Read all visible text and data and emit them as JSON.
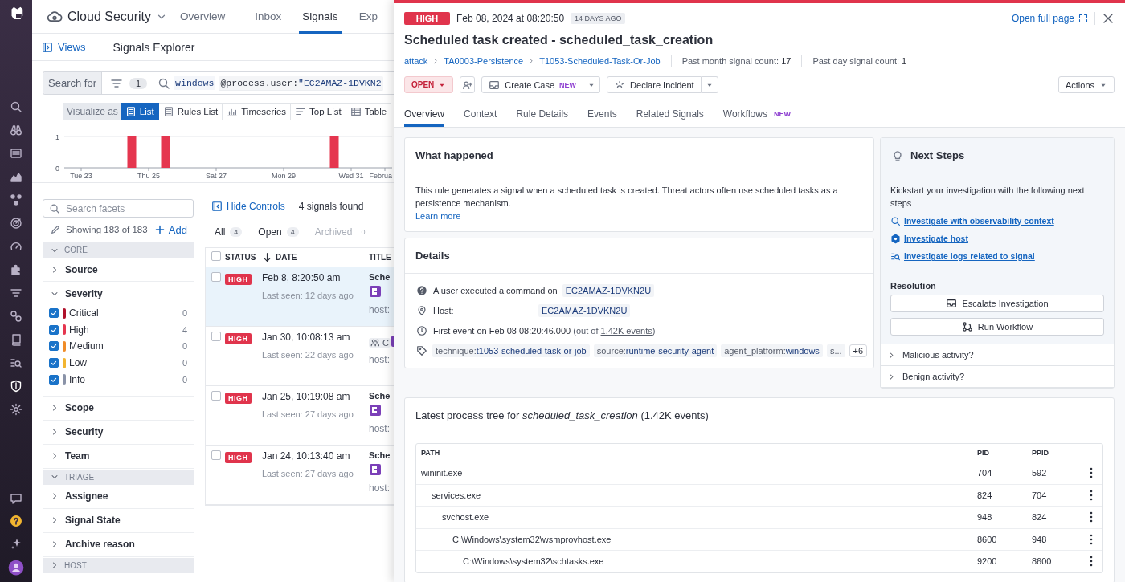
{
  "header": {
    "product": "Cloud Security",
    "tabs": [
      {
        "label": "Overview",
        "selected": false
      },
      {
        "label": "Inbox",
        "selected": false
      },
      {
        "label": "Signals",
        "selected": true
      },
      {
        "label": "Exp",
        "selected": false
      }
    ]
  },
  "subheader": {
    "views": "Views",
    "title": "Signals Explorer"
  },
  "search": {
    "label": "Search for",
    "filter_count": "1",
    "tokens": [
      {
        "kind": "keyword",
        "text": "windows"
      },
      {
        "kind": "facet",
        "key": "@process.user:",
        "value": "\"EC2AMAZ-1DVKN2"
      }
    ]
  },
  "visualize": {
    "label": "Visualize as",
    "options": [
      {
        "label": "List",
        "selected": true
      },
      {
        "label": "Rules List",
        "selected": false
      },
      {
        "label": "Timeseries",
        "selected": false
      },
      {
        "label": "Top List",
        "selected": false
      },
      {
        "label": "Table",
        "selected": false
      }
    ]
  },
  "histogram": {
    "chart_data": {
      "type": "bar",
      "categories": [
        "Tue 23",
        null,
        null,
        null,
        "Thu 25",
        null,
        null,
        null,
        "Sat 27",
        null,
        null,
        null,
        "Mon 29",
        null,
        null,
        null,
        "Wed 31",
        null,
        "Februa"
      ],
      "values": [
        0,
        0,
        0,
        1,
        0,
        1,
        0,
        0,
        0,
        0,
        0,
        0,
        0,
        0,
        0,
        1,
        0,
        0,
        0
      ],
      "ylim": [
        0,
        1
      ],
      "yticks": [
        0,
        1
      ]
    }
  },
  "facets": {
    "search_placeholder": "Search facets",
    "showing": "Showing 183 of 183",
    "add": "Add",
    "groups": [
      {
        "kind": "section",
        "label": "CORE",
        "expanded": true
      },
      {
        "kind": "facet",
        "label": "Source",
        "expanded": false
      },
      {
        "kind": "facet",
        "label": "Severity",
        "expanded": true,
        "options": [
          {
            "label": "Critical",
            "count": "0",
            "checked": true,
            "color": "#b0102a"
          },
          {
            "label": "High",
            "count": "4",
            "checked": true,
            "color": "#e5364f"
          },
          {
            "label": "Medium",
            "count": "0",
            "checked": true,
            "color": "#f08c28"
          },
          {
            "label": "Low",
            "count": "0",
            "checked": true,
            "color": "#f2b530"
          },
          {
            "label": "Info",
            "count": "0",
            "checked": true,
            "color": "#8a93a8"
          }
        ]
      },
      {
        "kind": "facet",
        "label": "Scope",
        "expanded": false
      },
      {
        "kind": "facet",
        "label": "Security",
        "expanded": false
      },
      {
        "kind": "facet",
        "label": "Team",
        "expanded": false
      },
      {
        "kind": "section",
        "label": "TRIAGE",
        "expanded": true
      },
      {
        "kind": "facet",
        "label": "Assignee",
        "expanded": false
      },
      {
        "kind": "facet",
        "label": "Signal State",
        "expanded": false
      },
      {
        "kind": "facet",
        "label": "Archive reason",
        "expanded": false
      },
      {
        "kind": "section",
        "label": "HOST",
        "expanded": false
      }
    ]
  },
  "signals": {
    "hide_controls": "Hide Controls",
    "found": "4 signals found",
    "filters": [
      {
        "label": "All",
        "count": "4",
        "disabled": false
      },
      {
        "label": "Open",
        "count": "4",
        "disabled": false
      },
      {
        "label": "Archived",
        "count": "0",
        "disabled": true
      }
    ],
    "select_all_checked": false,
    "columns": [
      "STATUS",
      "DATE",
      "TITLE"
    ],
    "rows": [
      {
        "kind": "text",
        "severity": "HIGH",
        "date": "Feb 8, 8:20:50 am",
        "last_seen": "Last seen: 12 days ago",
        "title": "Sche",
        "host": "host:",
        "selected": true,
        "checked": false
      },
      {
        "kind": "case",
        "severity": "HIGH",
        "date": "Jan 30, 10:08:13 am",
        "last_seen": "Last seen: 22 days ago",
        "title": "C",
        "host": "host:",
        "selected": false,
        "checked": false
      },
      {
        "kind": "text",
        "severity": "HIGH",
        "date": "Jan 25, 10:19:08 am",
        "last_seen": "Last seen: 27 days ago",
        "title": "Sche",
        "host": "host:",
        "selected": false,
        "checked": false
      },
      {
        "kind": "text",
        "severity": "HIGH",
        "date": "Jan 24, 10:13:40 am",
        "last_seen": "Last seen: 27 days ago",
        "title": "Sche",
        "host": "host:",
        "selected": false,
        "checked": false
      }
    ]
  },
  "panel": {
    "severity": "HIGH",
    "timestamp": "Feb 08, 2024 at 08:20:50",
    "age": "14 DAYS AGO",
    "open_full_page": "Open full page",
    "title": "Scheduled task created - scheduled_task_creation",
    "breadcrumbs": [
      "attack",
      "TA0003-Persistence",
      "T1053-Scheduled-Task-Or-Job"
    ],
    "counts": [
      "Past month signal count: **17**",
      "Past day signal count: **1**"
    ],
    "status": "OPEN",
    "create_case": {
      "label": "Create Case",
      "badge": "NEW"
    },
    "declare_incident": "Declare Incident",
    "actions": "Actions",
    "tabs": [
      {
        "label": "Overview",
        "selected": true
      },
      {
        "label": "Context",
        "selected": false
      },
      {
        "label": "Rule Details",
        "selected": false
      },
      {
        "label": "Events",
        "selected": false
      },
      {
        "label": "Related Signals",
        "selected": false
      },
      {
        "label": "Workflows",
        "selected": false,
        "badge": "NEW"
      }
    ]
  },
  "what_happened": {
    "title": "What happened",
    "text": "This rule generates a signal when a scheduled task is created. Threat actors often use scheduled tasks as a persistence mechanism.",
    "link": "Learn more"
  },
  "details": {
    "title": "Details",
    "items": [
      {
        "kind": "message",
        "text": "A user executed a command on",
        "value": "EC2AMAZ-1DVKN2U"
      },
      {
        "kind": "host",
        "text": "Host:",
        "value": "EC2AMAZ-1DVKN2U"
      },
      {
        "kind": "time",
        "text": "First event on Feb 08 08:20:46.000",
        "note": "(out of ",
        "link": "1.42K events",
        "note_end": ")"
      }
    ],
    "tags": [
      {
        "key": "technique:",
        "value": "t1053-scheduled-task-or-job"
      },
      {
        "key": "source:",
        "value": "runtime-security-agent"
      },
      {
        "key": "agent_platform:",
        "value": "windows"
      },
      {
        "key": "s..."
      }
    ],
    "more_tags": "+6"
  },
  "next_steps": {
    "title": "Next Steps",
    "intro": "Kickstart your investigation with the following next steps",
    "links": [
      {
        "kind": "search",
        "label": "Investigate with observability context"
      },
      {
        "kind": "host",
        "label": "Investigate host"
      },
      {
        "kind": "logs",
        "label": "Investigate logs related to signal"
      }
    ],
    "resolution": {
      "title": "Resolution",
      "buttons": [
        {
          "kind": "escalate",
          "label": "Escalate Investigation"
        },
        {
          "kind": "workflow",
          "label": "Run Workflow"
        }
      ]
    },
    "questions": [
      {
        "label": "Malicious activity?",
        "expanded": false
      },
      {
        "label": "Benign activity?",
        "expanded": false
      }
    ]
  },
  "process_tree": {
    "title": "Latest process tree for *scheduled_task_creation* (1.42K events)",
    "columns": [
      "PATH",
      "PID",
      "PPID"
    ],
    "rows": [
      {
        "path": "wininit.exe",
        "pid": "704",
        "ppid": "592",
        "children": [
          {
            "path": "services.exe",
            "pid": "824",
            "ppid": "704",
            "children": [
              {
                "path": "svchost.exe",
                "pid": "948",
                "ppid": "824",
                "children": [
                  {
                    "path": "C:\\Windows\\system32\\wsmprovhost.exe",
                    "pid": "8600",
                    "ppid": "948",
                    "children": [
                      {
                        "path": "C:\\Windows\\system32\\schtasks.exe",
                        "pid": "9200",
                        "ppid": "8600"
                      }
                    ]
                  }
                ]
              }
            ]
          }
        ]
      }
    ]
  }
}
